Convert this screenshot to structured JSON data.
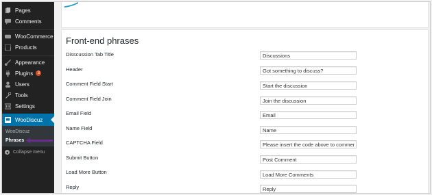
{
  "sidebar": {
    "items": [
      {
        "label": "Pages",
        "icon": "pages-icon"
      },
      {
        "label": "Comments",
        "icon": "comments-icon"
      },
      {
        "label": "WooCommerce",
        "icon": "woocommerce-icon"
      },
      {
        "label": "Products",
        "icon": "products-icon"
      },
      {
        "label": "Appearance",
        "icon": "appearance-icon"
      },
      {
        "label": "Plugins",
        "icon": "plugins-icon",
        "badge": "3"
      },
      {
        "label": "Users",
        "icon": "users-icon"
      },
      {
        "label": "Tools",
        "icon": "tools-icon"
      },
      {
        "label": "Settings",
        "icon": "settings-icon"
      },
      {
        "label": "WooDiscuz",
        "icon": "woodiscuz-icon",
        "active": true
      }
    ],
    "submenu": [
      {
        "label": "WooDiscuz"
      },
      {
        "label": "Phrases",
        "current": true
      }
    ],
    "collapse_label": "Collapse menu"
  },
  "main": {
    "section_title": "Front-end phrases",
    "rows": [
      {
        "label": "Disscussion Tab Title",
        "value": "Discussions"
      },
      {
        "label": "Header",
        "value": "Got something to discuss?"
      },
      {
        "label": "Comment Field Start",
        "value": "Start the discussion"
      },
      {
        "label": "Comment Field Join",
        "value": "Join the discussion"
      },
      {
        "label": "Email Field",
        "value": "Email"
      },
      {
        "label": "Name Field",
        "value": "Name"
      },
      {
        "label": "CAPTCHA Field",
        "value": "Please insert the code above to comment"
      },
      {
        "label": "Submit Button",
        "value": "Post Comment"
      },
      {
        "label": "Load More Button",
        "value": "Load More Comments"
      },
      {
        "label": "Reply",
        "value": "Reply"
      }
    ]
  },
  "colors": {
    "sidebar_bg": "#222222",
    "active_bg": "#0073aa",
    "annotation_arrow": "#6a2c8e",
    "accent_tab": "#2ea2cc"
  }
}
